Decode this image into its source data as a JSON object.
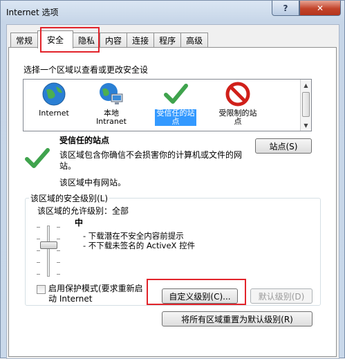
{
  "window": {
    "title": "Internet 选项",
    "help": "?",
    "close": "✕"
  },
  "tabs": [
    "常规",
    "安全",
    "隐私",
    "内容",
    "连接",
    "程序",
    "高级"
  ],
  "active_tab": "安全",
  "zones": {
    "prompt": "选择一个区域以查看或更改安全设",
    "items": [
      {
        "label": "Internet",
        "icon": "globe-icon"
      },
      {
        "label": "本地 Intranet",
        "icon": "intranet-globe-icon"
      },
      {
        "label": "受信任的站点",
        "icon": "checkmark-icon",
        "selected": true
      },
      {
        "label": "受限制的站点",
        "icon": "restricted-icon"
      }
    ]
  },
  "zone_detail": {
    "title": "受信任的站点",
    "description": "该区域包含你确信不会损害你的计算机或文件的网站。",
    "has_sites": "该区域中有网站。",
    "sites_button": "站点(S)"
  },
  "security_level": {
    "group_label": "该区域的安全级别(L)",
    "allowed_levels": "该区域的允许级别：全部",
    "level_name": "中",
    "bullets": [
      "- 下载潜在不安全内容前提示",
      "- 不下载未签名的 ActiveX 控件"
    ],
    "slider_value": "中"
  },
  "protected_mode": {
    "label": "启用保护模式(要求重新启动 Internet",
    "checked": false
  },
  "buttons": {
    "custom_level": "自定义级别(C)...",
    "default_level": "默认级别(D)",
    "reset_all": "将所有区域重置为默认级别(R)"
  },
  "colors": {
    "highlight": "#3399ff",
    "red_outline": "#e2232a",
    "close_red": "#c2432a"
  }
}
